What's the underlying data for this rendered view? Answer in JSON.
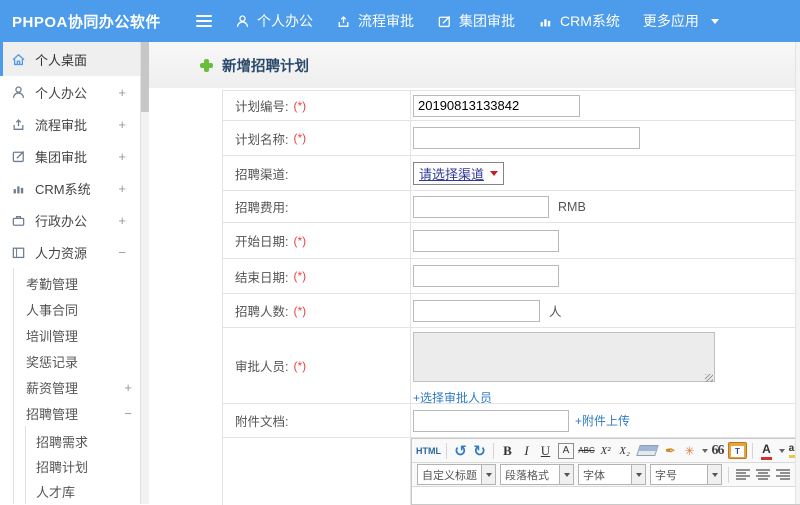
{
  "colors": {
    "topbar_blue": "#4c9ceb",
    "link_blue": "#2f7cc4",
    "required_red": "#e64545",
    "title_navy": "#2b4a6b",
    "plus_green": "#6abe3b",
    "select_text_navy": "#323a96",
    "select_caret_red": "#c22222"
  },
  "topbar": {
    "logo": "PHPOA协同办公软件",
    "nav": [
      {
        "label": "个人办公"
      },
      {
        "label": "流程审批"
      },
      {
        "label": "集团审批"
      },
      {
        "label": "CRM系统"
      },
      {
        "label": "更多应用"
      }
    ]
  },
  "sidebar": {
    "items": [
      {
        "label": "个人桌面"
      },
      {
        "label": "个人办公",
        "exp": "+"
      },
      {
        "label": "流程审批",
        "exp": "+"
      },
      {
        "label": "集团审批",
        "exp": "+"
      },
      {
        "label": "CRM系统",
        "exp": "+"
      },
      {
        "label": "行政办公",
        "exp": "+"
      },
      {
        "label": "人力资源",
        "exp": "−"
      },
      {
        "label": "考勤管理"
      },
      {
        "label": "人事合同"
      },
      {
        "label": "培训管理"
      },
      {
        "label": "奖惩记录"
      },
      {
        "label": "薪资管理",
        "exp": "+"
      },
      {
        "label": "招聘管理",
        "exp": "−"
      },
      {
        "label": "招聘需求"
      },
      {
        "label": "招聘计划"
      },
      {
        "label": "人才库"
      }
    ]
  },
  "page": {
    "title": "新增招聘计划"
  },
  "form": {
    "rows": [
      {
        "label": "计划编号:",
        "required": "(*)",
        "value": "20190813133842"
      },
      {
        "label": "计划名称:",
        "required": "(*)",
        "value": ""
      },
      {
        "label": "招聘渠道:",
        "select_value": "请选择渠道"
      },
      {
        "label": "招聘费用:",
        "suffix": "RMB"
      },
      {
        "label": "开始日期:",
        "required": "(*)"
      },
      {
        "label": "结束日期:",
        "required": "(*)"
      },
      {
        "label": "招聘人数:",
        "required": "(*)",
        "suffix": "人"
      },
      {
        "label": "审批人员:",
        "required": "(*)",
        "link": "+选择审批人员"
      },
      {
        "label": "附件文档:",
        "link": "+附件上传"
      }
    ]
  },
  "editor": {
    "html_label": "HTML",
    "icons": {
      "bold": "B",
      "italic": "I",
      "underline": "U",
      "boxed_a": "A",
      "strike": "ABC",
      "superscript": "X²",
      "subscript": "X₂",
      "blockquote": "66",
      "font_color": "A",
      "highlight": "ab",
      "paste": "T"
    },
    "combos": [
      {
        "label": "自定义标题"
      },
      {
        "label": "段落格式"
      },
      {
        "label": "字体"
      },
      {
        "label": "字号"
      }
    ]
  }
}
